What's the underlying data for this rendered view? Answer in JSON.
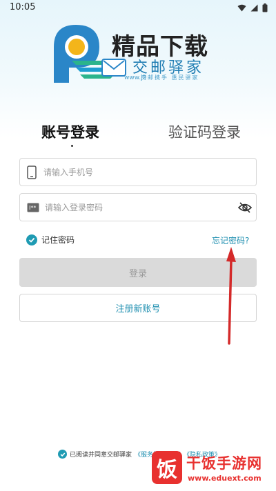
{
  "status_bar": {
    "time": "10:05"
  },
  "logo": {
    "title": "精品下载",
    "subtitle": "交邮驿家",
    "url": "www.j9",
    "slogan": "交邮携手  惠民驿家"
  },
  "tabs": [
    {
      "label": "账号登录",
      "active": true
    },
    {
      "label": "验证码登录",
      "active": false
    }
  ],
  "form": {
    "phone": {
      "value": "",
      "placeholder": "请输入手机号"
    },
    "password": {
      "value": "",
      "placeholder": "请输入登录密码"
    },
    "remember_label": "记住密码",
    "remember_checked": true,
    "forgot_label": "忘记密码?",
    "login_label": "登录",
    "register_label": "注册新账号"
  },
  "agreement": {
    "checked": true,
    "prefix": "已阅读并同意交邮驿家",
    "service_link": "《服务协议》",
    "and": "和",
    "privacy_link": "《隐私政策》"
  },
  "watermark": {
    "icon_char": "饭",
    "title": "干饭手游网",
    "url": "www.eduext.com"
  },
  "colors": {
    "accent": "#1f8fb0",
    "check": "#1f9bb3",
    "annotation_arrow": "#d42a2a",
    "watermark": "#e8312f",
    "login_disabled_bg": "#dadada"
  }
}
